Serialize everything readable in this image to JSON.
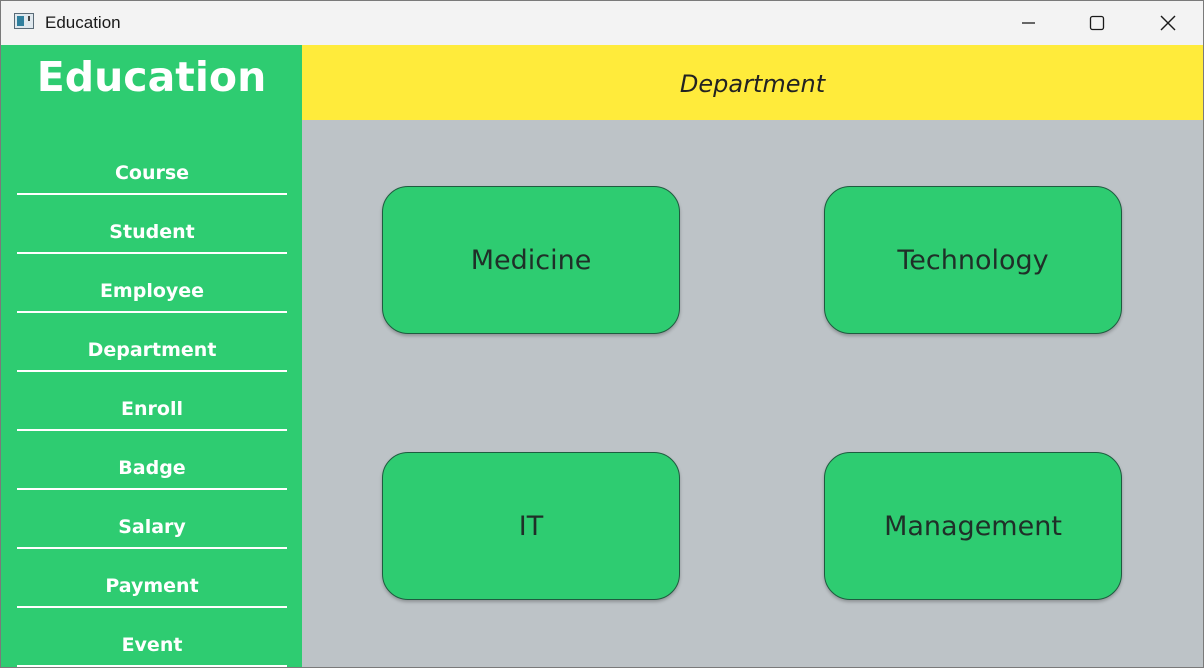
{
  "window": {
    "title": "Education",
    "icon": "app-window-icon"
  },
  "sidebar": {
    "title": "Education",
    "items": [
      {
        "label": "Course"
      },
      {
        "label": "Student"
      },
      {
        "label": "Employee"
      },
      {
        "label": "Department"
      },
      {
        "label": "Enroll"
      },
      {
        "label": "Badge"
      },
      {
        "label": "Salary"
      },
      {
        "label": "Payment"
      },
      {
        "label": "Event"
      }
    ]
  },
  "header": {
    "title": "Department"
  },
  "departments": [
    {
      "label": "Medicine"
    },
    {
      "label": "Technology"
    },
    {
      "label": "IT"
    },
    {
      "label": "Management"
    }
  ],
  "colors": {
    "sidebar": "#2ecc71",
    "header": "#ffeb3b",
    "content": "#bdc3c7",
    "card": "#2ecc71"
  }
}
